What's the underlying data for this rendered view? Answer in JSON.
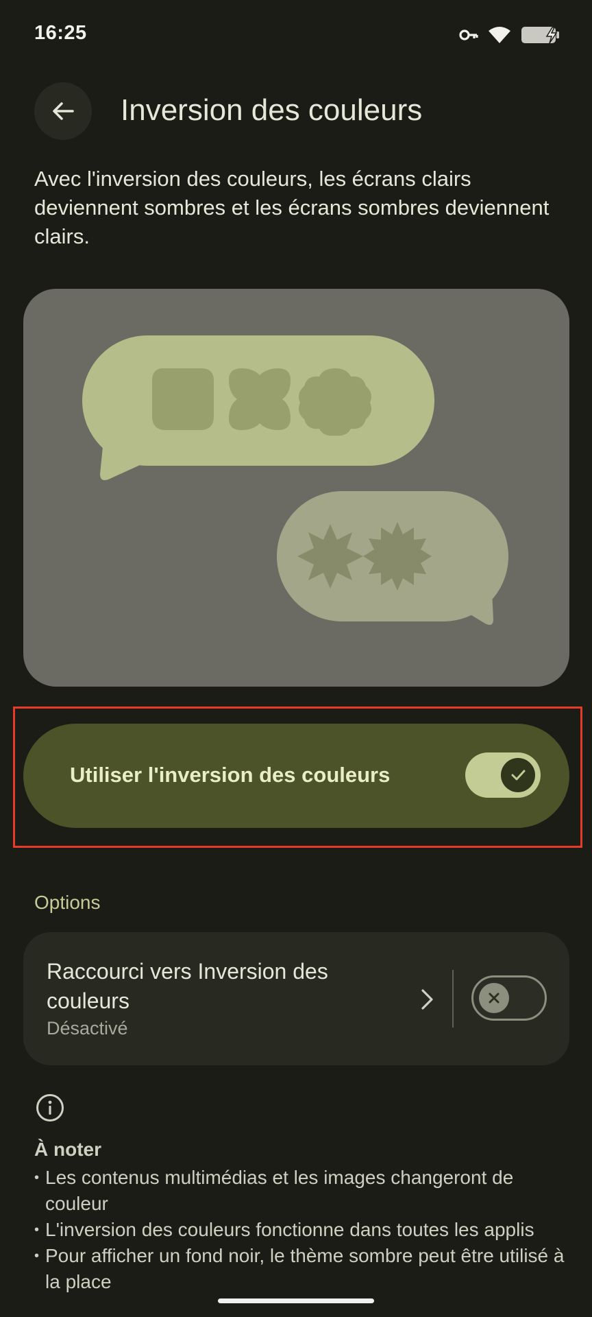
{
  "status_bar": {
    "time": "16:25"
  },
  "header": {
    "title": "Inversion des couleurs"
  },
  "description": "Avec l'inversion des couleurs, les écrans clairs deviennent sombres et les écrans sombres deviennent clairs.",
  "main_toggle": {
    "label": "Utiliser l'inversion des couleurs",
    "checked": true
  },
  "options": {
    "section_label": "Options",
    "shortcut": {
      "title": "Raccourci vers Inversion des couleurs",
      "subtitle": "Désactivé",
      "enabled": false
    }
  },
  "note": {
    "title": "À noter",
    "items": [
      "Les contenus multimédias et les images changeront de couleur",
      "L'inversion des couleurs fonctionne dans toutes les applis",
      "Pour afficher un fond noir, le thème sombre peut être utilisé à la place"
    ]
  },
  "colors": {
    "background": "#1b1c16",
    "accent_card": "#4d5328",
    "switch_on_track": "#c4cc95",
    "highlight_border": "#e53b28"
  },
  "icons": [
    "key-icon",
    "wifi-icon",
    "battery-charging-icon",
    "back-arrow-icon",
    "check-icon",
    "chevron-right-icon",
    "close-icon",
    "info-icon"
  ]
}
